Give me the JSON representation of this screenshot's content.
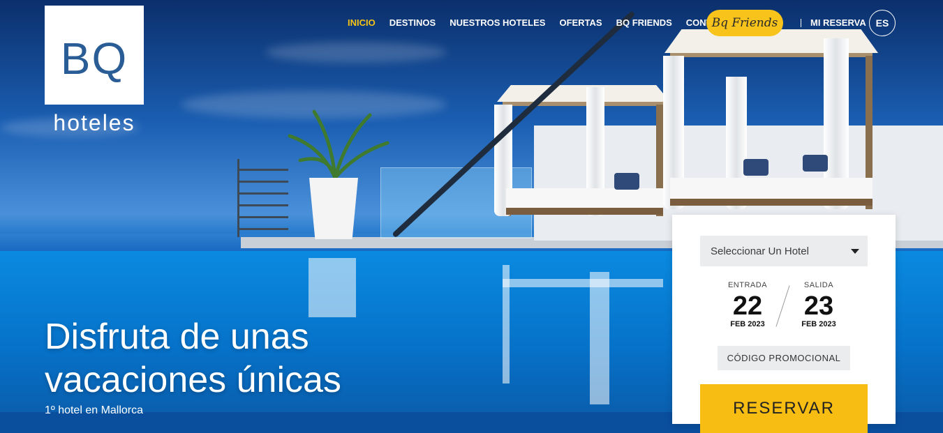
{
  "brand": {
    "logo_text": "BQ",
    "logo_subtext": "hoteles"
  },
  "nav": {
    "items": [
      {
        "label": "INICIO",
        "active": true
      },
      {
        "label": "DESTINOS"
      },
      {
        "label": "NUESTROS HOTELES"
      },
      {
        "label": "OFERTAS"
      },
      {
        "label": "BQ FRIENDS"
      },
      {
        "label": "CONTACTO"
      }
    ],
    "friends_button": "Bq Friends",
    "mi_reserva": "MI RESERVA",
    "language": "ES"
  },
  "hero": {
    "headline_line1": "Disfruta de unas",
    "headline_line2": "vacaciones únicas",
    "subline": "1º hotel en Mallorca"
  },
  "booking": {
    "hotel_select_value": "Seleccionar Un Hotel",
    "checkin": {
      "label": "ENTRADA",
      "day": "22",
      "month_year": "FEB 2023"
    },
    "checkout": {
      "label": "SALIDA",
      "day": "23",
      "month_year": "FEB 2023"
    },
    "promo_label": "CÓDIGO PROMOCIONAL",
    "reserve_label": "RESERVAR"
  },
  "colors": {
    "accent": "#f8c31a",
    "logo_blue": "#2a5d96",
    "nav_active": "#f6c317"
  }
}
